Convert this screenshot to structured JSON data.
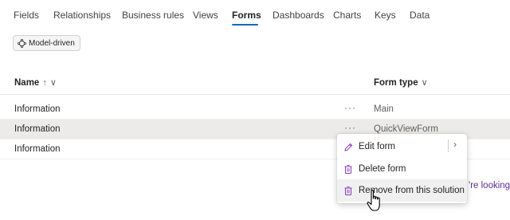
{
  "tabs": [
    {
      "label": "Fields"
    },
    {
      "label": "Relationships"
    },
    {
      "label": "Business rules"
    },
    {
      "label": "Views"
    },
    {
      "label": "Forms",
      "active": true
    },
    {
      "label": "Dashboards"
    },
    {
      "label": "Charts"
    },
    {
      "label": "Keys"
    },
    {
      "label": "Data"
    }
  ],
  "filter": {
    "label": "Model-driven",
    "icon": "model-driven-icon"
  },
  "table": {
    "columns": {
      "name": {
        "label": "Name",
        "sort": "↑",
        "chevron": "∨"
      },
      "form_type": {
        "label": "Form type",
        "chevron": "∨"
      }
    },
    "rows": [
      {
        "name": "Information",
        "more": "···",
        "form_type": "Main"
      },
      {
        "name": "Information",
        "more": "···",
        "form_type": "QuickViewForm",
        "selected": true
      },
      {
        "name": "Information",
        "more": "",
        "form_type": ""
      }
    ]
  },
  "context_menu": {
    "items": [
      {
        "label": "Edit form",
        "icon": "pencil-icon",
        "submenu": "›"
      },
      {
        "label": "Delete form",
        "icon": "trash-icon"
      },
      {
        "label": "Remove from this solution",
        "icon": "trash-icon",
        "hover": true
      }
    ]
  },
  "background_partial_text": "'re looking",
  "colors": {
    "accent": "#0f6cbd",
    "selected_row": "#edebe9",
    "link": "#5c2d91"
  }
}
